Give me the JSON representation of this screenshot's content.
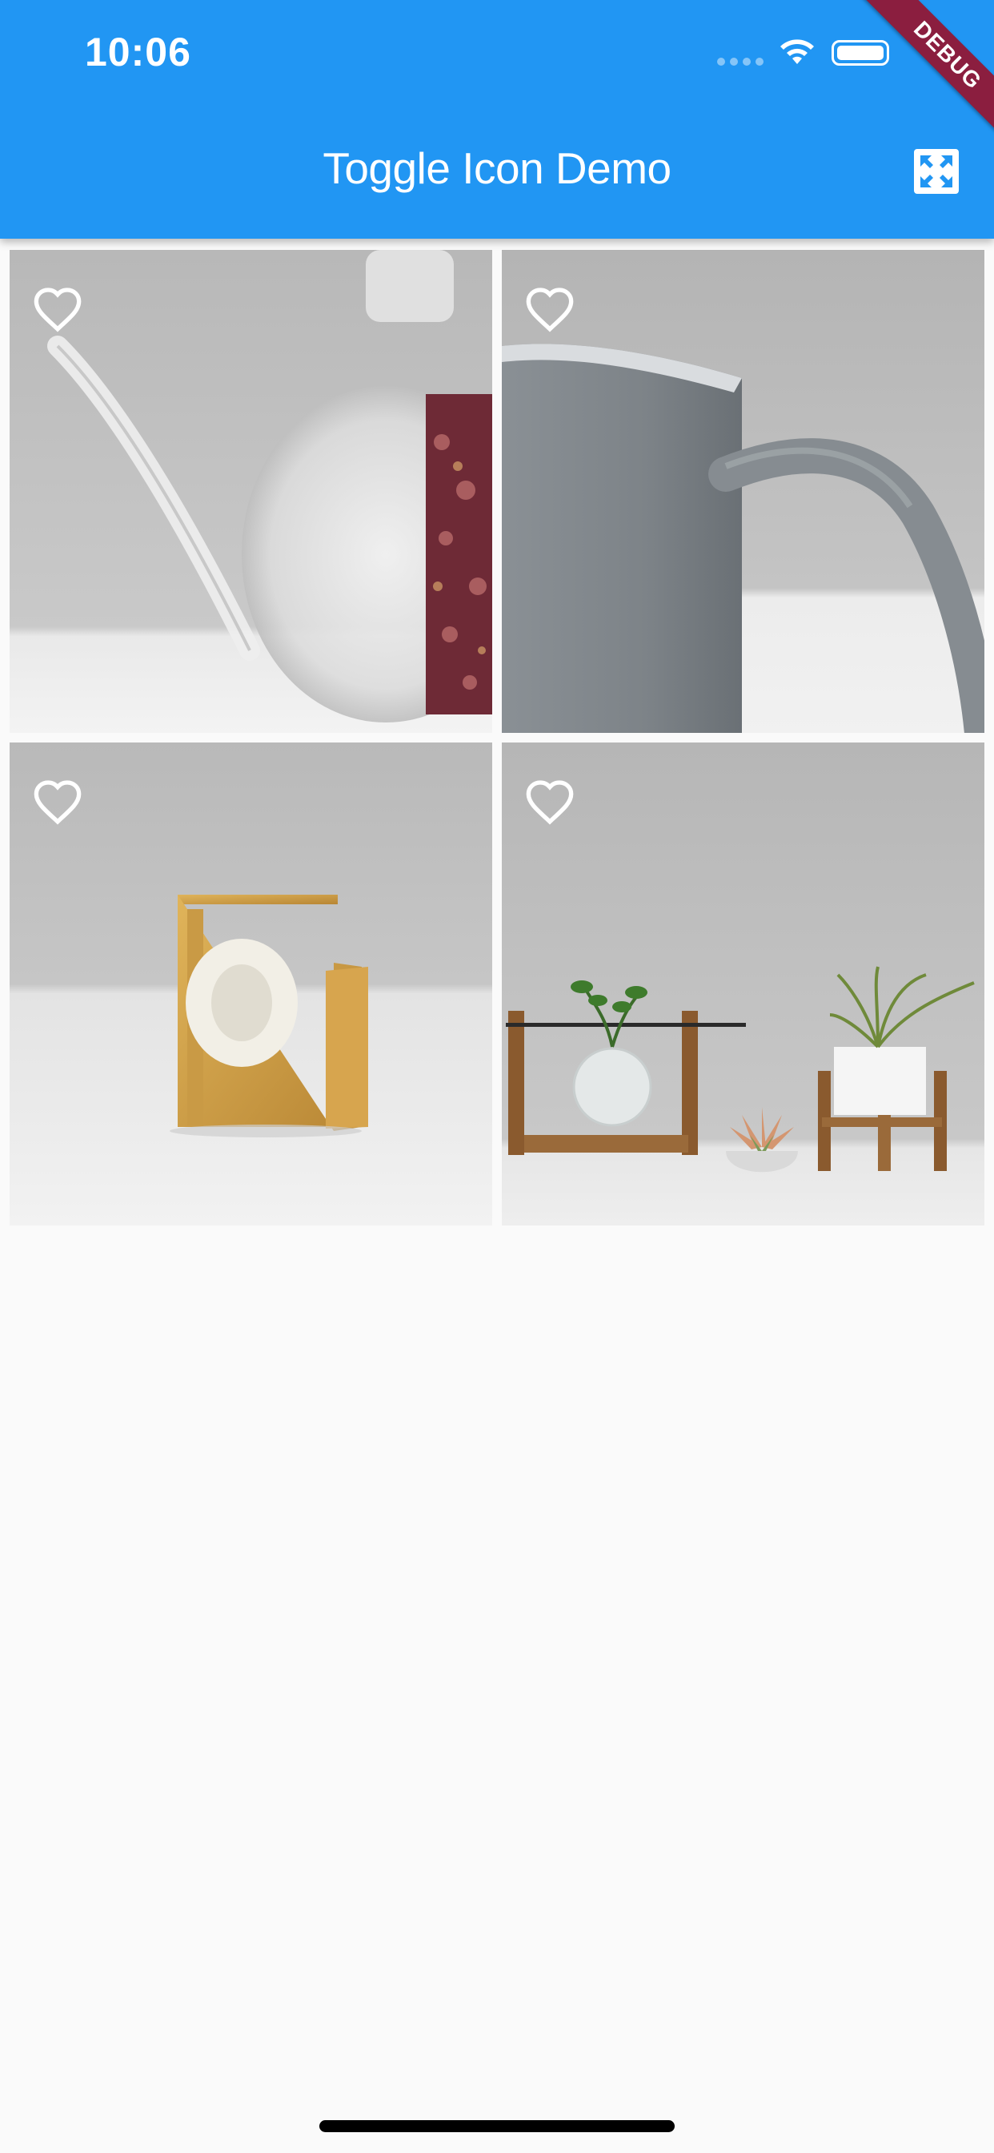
{
  "status_bar": {
    "time": "10:06"
  },
  "app_bar": {
    "title": "Toggle Icon Demo",
    "action_icon": "fullscreen-icon"
  },
  "debug_banner": {
    "label": "DEBUG",
    "color": "#8b1e3f"
  },
  "colors": {
    "primary": "#2196f3",
    "background": "#fafafa",
    "icon": "#ffffff"
  },
  "grid": {
    "columns": 2,
    "items": [
      {
        "image": "glass teapot with dried rose petals",
        "favorite": false,
        "icon": "heart-outline-icon"
      },
      {
        "image": "gray ceramic mug",
        "favorite": false,
        "icon": "heart-outline-icon"
      },
      {
        "image": "gold tape dispenser",
        "favorite": false,
        "icon": "heart-outline-icon"
      },
      {
        "image": "plants on wooden stands",
        "favorite": false,
        "icon": "heart-outline-icon"
      }
    ]
  }
}
